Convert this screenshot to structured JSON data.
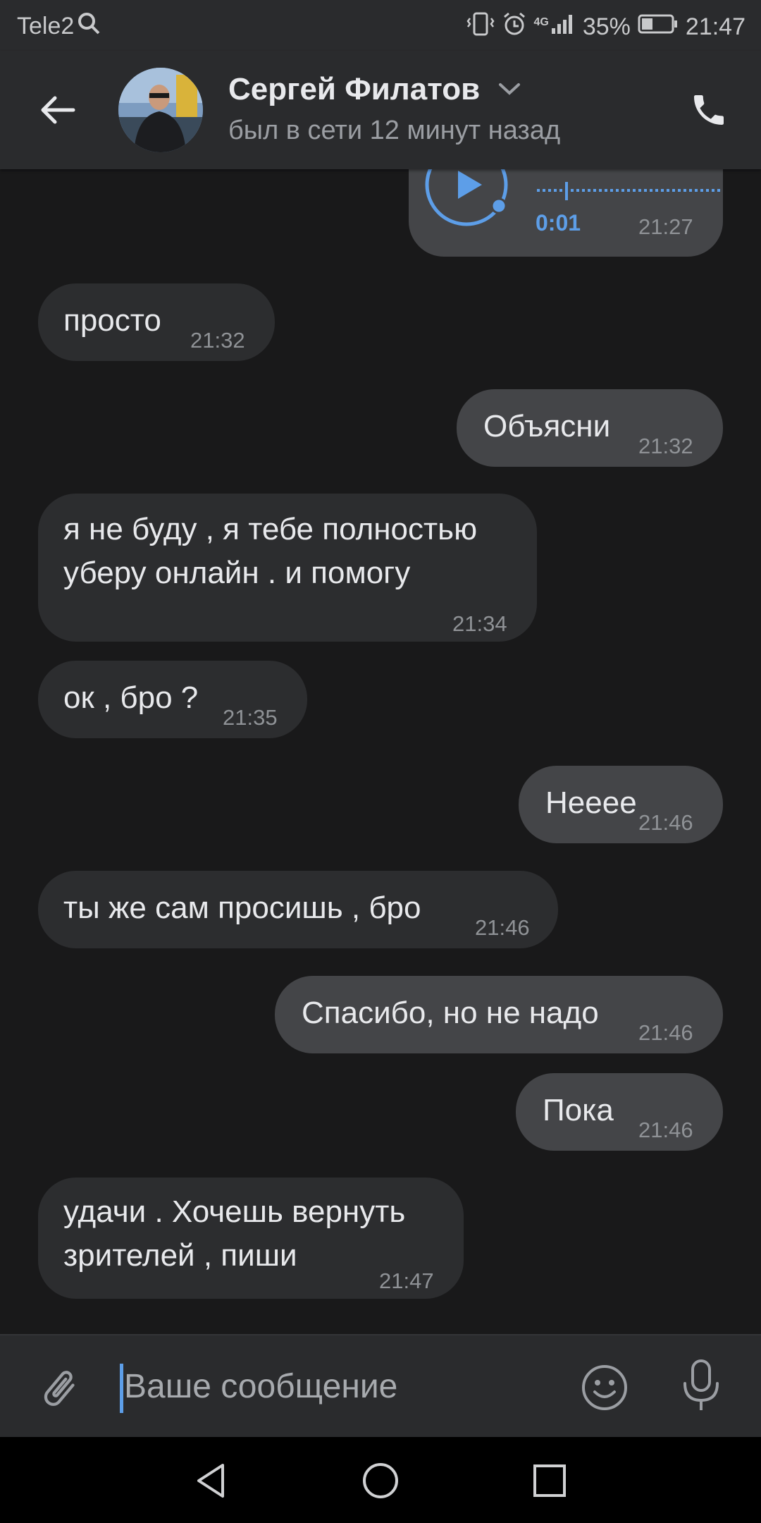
{
  "status_bar": {
    "carrier": "Tele2",
    "network": "4G",
    "battery": "35%",
    "time": "21:47",
    "icons": [
      "search-icon",
      "vibrate-icon",
      "alarm-icon",
      "signal-icon",
      "battery-icon"
    ]
  },
  "header": {
    "name": "Сергей Филатов",
    "status": "был в сети 12 минут назад",
    "icons": [
      "back-arrow-icon",
      "chevron-down-icon",
      "phone-icon"
    ]
  },
  "voice_message": {
    "duration": "0:01",
    "time": "21:27",
    "icons": [
      "play-icon"
    ]
  },
  "messages": [
    {
      "dir": "in",
      "text": "просто",
      "time": "21:32"
    },
    {
      "dir": "out",
      "text": "Объясни",
      "time": "21:32"
    },
    {
      "dir": "in",
      "text": "я не буду , я тебе полностью\nуберу онлайн . и помогу",
      "time": "21:34"
    },
    {
      "dir": "in",
      "text": "ок , бро ?",
      "time": "21:35"
    },
    {
      "dir": "out",
      "text": "Нееее",
      "time": "21:46"
    },
    {
      "dir": "in",
      "text": "ты же сам просишь , бро",
      "time": "21:46"
    },
    {
      "dir": "out",
      "text": "Спасибо, но не надо",
      "time": "21:46"
    },
    {
      "dir": "out",
      "text": "Пока",
      "time": "21:46"
    },
    {
      "dir": "in",
      "text": "удачи . Хочешь вернуть\nзрителей , пиши",
      "time": "21:47"
    }
  ],
  "composer": {
    "placeholder": "Ваше сообщение",
    "icons": [
      "attach-icon",
      "emoji-icon",
      "microphone-icon"
    ]
  },
  "nav": {
    "icons": [
      "nav-back-icon",
      "nav-home-icon",
      "nav-recents-icon"
    ]
  },
  "colors": {
    "background": "#19191a",
    "incoming_bubble": "#2c2d2f",
    "outgoing_bubble": "#444548",
    "accent": "#5d9ee8"
  }
}
